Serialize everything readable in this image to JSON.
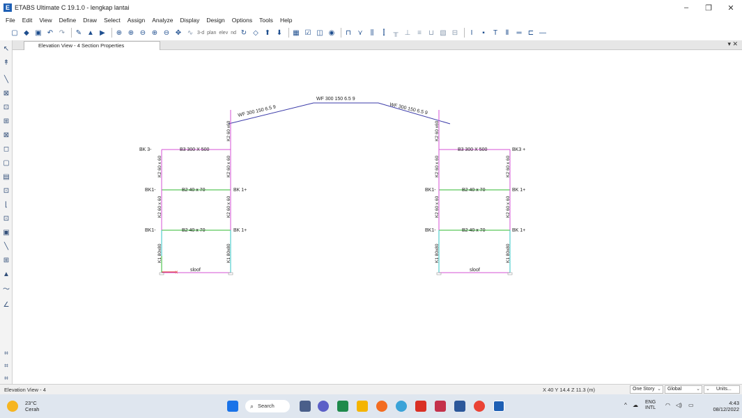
{
  "window": {
    "title": "ETABS Ultimate C 19.1.0 - lengkap lantai",
    "logo_letter": "E",
    "controls": [
      "–",
      "❐",
      "✕"
    ]
  },
  "menu": [
    "File",
    "Edit",
    "View",
    "Define",
    "Draw",
    "Select",
    "Assign",
    "Analyze",
    "Display",
    "Design",
    "Options",
    "Tools",
    "Help"
  ],
  "toolbar": {
    "view_labels": [
      "3-d",
      "plan",
      "elev",
      "nd"
    ]
  },
  "document_tab": {
    "title": "Elevation View - 4 Section Properties",
    "controls": "▾ ✕"
  },
  "drawing": {
    "roof_beams": [
      "WF 300 150 6.5 9",
      "WF 300 150 6.5 9",
      "WF 300 150 6.5 9"
    ],
    "beams": {
      "b3": "B3 300 X 500",
      "b2": "B2 40 x 70",
      "sloof": "sloof"
    },
    "joint_labels": {
      "bk3_left": "BK 3-",
      "bk3_right": "BK3 +",
      "bk1_left": "BK1-",
      "bk1_right": "BK 1+"
    },
    "columns": {
      "k1": "K1 80x80",
      "k2": "K2 60 x 60",
      "k2_roof": "K2 60 x60"
    },
    "colors": {
      "roof": "#3a3aa8",
      "b3": "#d452d4",
      "b2": "#2fb82f",
      "sloof": "#d452d4",
      "k2": "#d452d4",
      "k1": "#31c4c4",
      "marker_red": "#e02020"
    }
  },
  "status": {
    "view_name": "Elevation View - 4",
    "coordinates": "X 40  Y 14.4  Z 11.3 (m)",
    "story_mode": "One Story",
    "coord_system": "Global",
    "units": "Units..."
  },
  "taskbar": {
    "temperature": "23°C",
    "weather": "Cerah",
    "search": "Search",
    "lang_top": "ENG",
    "lang_bottom": "INTL",
    "time": "4:43",
    "date": "08/12/2022"
  }
}
